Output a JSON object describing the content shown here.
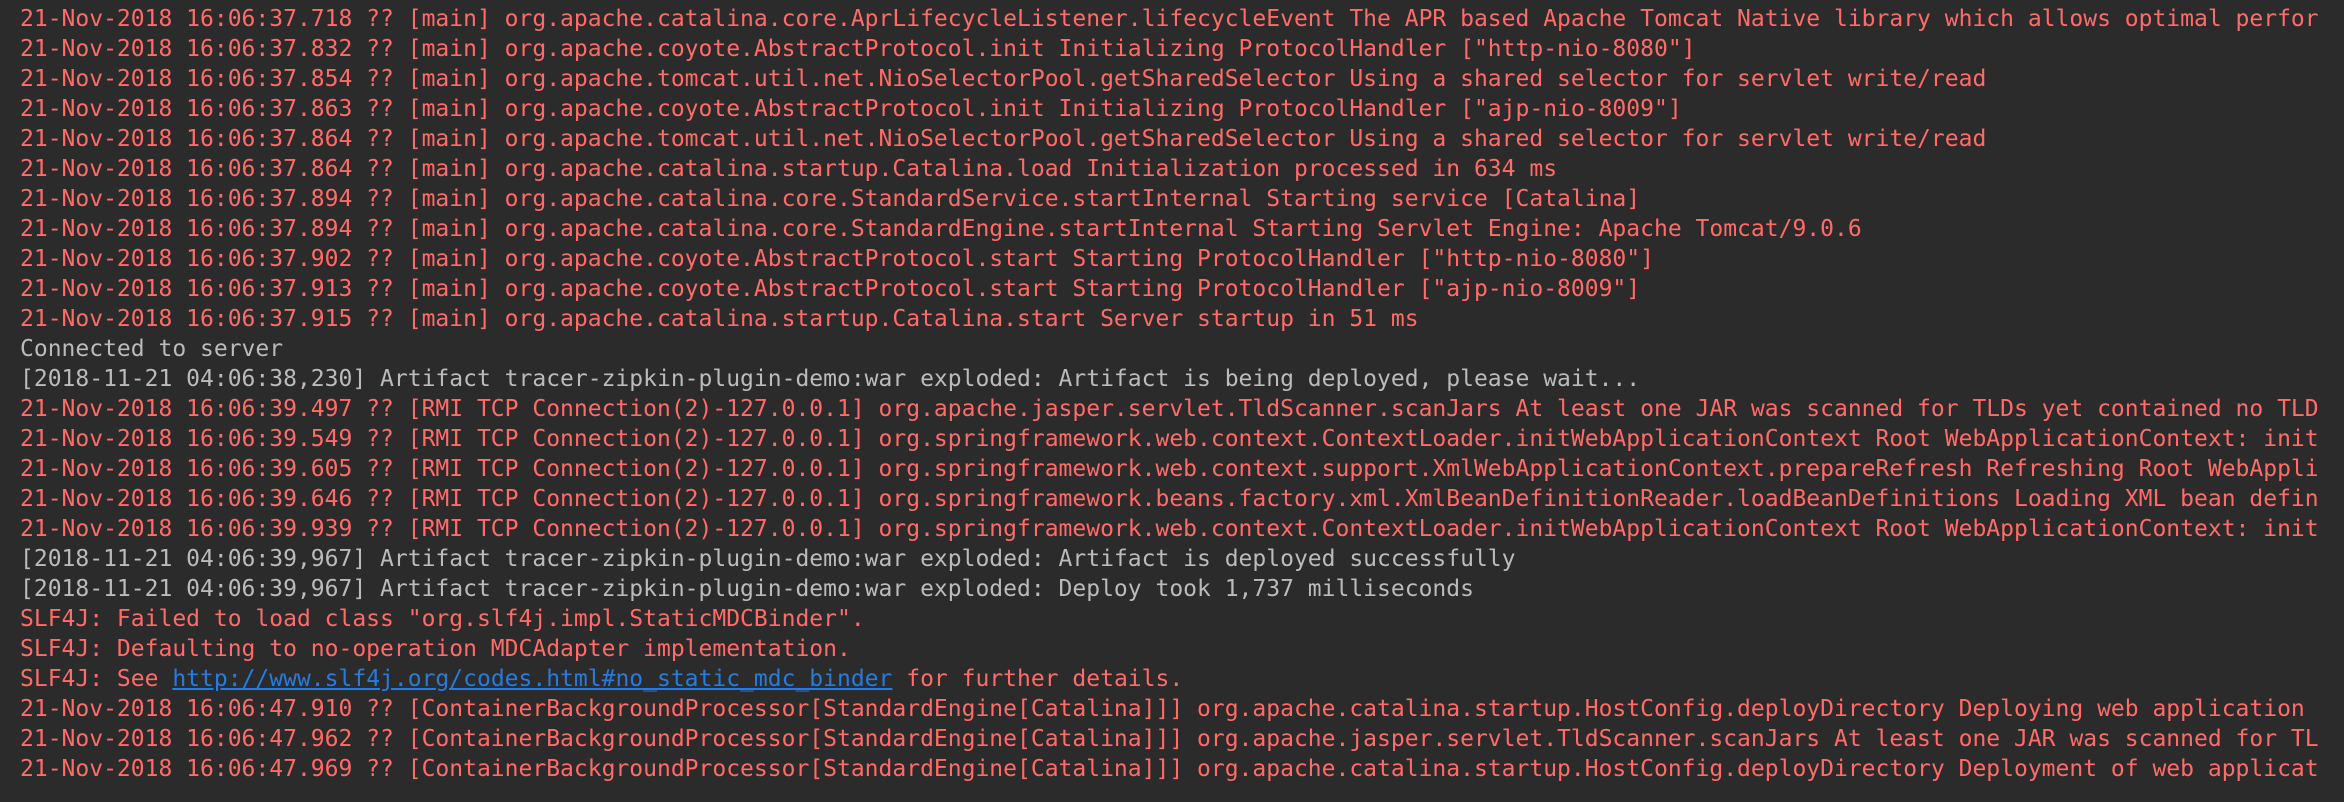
{
  "colors": {
    "background": "#2b2b2b",
    "stderr": "#ff6b68",
    "stdout": "#bbbbbb",
    "link": "#287bde"
  },
  "lines": [
    {
      "kind": "err",
      "text": "21-Nov-2018 16:06:37.718 ?? [main] org.apache.catalina.core.AprLifecycleListener.lifecycleEvent The APR based Apache Tomcat Native library which allows optimal perfor"
    },
    {
      "kind": "err",
      "text": "21-Nov-2018 16:06:37.832 ?? [main] org.apache.coyote.AbstractProtocol.init Initializing ProtocolHandler [\"http-nio-8080\"]"
    },
    {
      "kind": "err",
      "text": "21-Nov-2018 16:06:37.854 ?? [main] org.apache.tomcat.util.net.NioSelectorPool.getSharedSelector Using a shared selector for servlet write/read"
    },
    {
      "kind": "err",
      "text": "21-Nov-2018 16:06:37.863 ?? [main] org.apache.coyote.AbstractProtocol.init Initializing ProtocolHandler [\"ajp-nio-8009\"]"
    },
    {
      "kind": "err",
      "text": "21-Nov-2018 16:06:37.864 ?? [main] org.apache.tomcat.util.net.NioSelectorPool.getSharedSelector Using a shared selector for servlet write/read"
    },
    {
      "kind": "err",
      "text": "21-Nov-2018 16:06:37.864 ?? [main] org.apache.catalina.startup.Catalina.load Initialization processed in 634 ms"
    },
    {
      "kind": "err",
      "text": "21-Nov-2018 16:06:37.894 ?? [main] org.apache.catalina.core.StandardService.startInternal Starting service [Catalina]"
    },
    {
      "kind": "err",
      "text": "21-Nov-2018 16:06:37.894 ?? [main] org.apache.catalina.core.StandardEngine.startInternal Starting Servlet Engine: Apache Tomcat/9.0.6"
    },
    {
      "kind": "err",
      "text": "21-Nov-2018 16:06:37.902 ?? [main] org.apache.coyote.AbstractProtocol.start Starting ProtocolHandler [\"http-nio-8080\"]"
    },
    {
      "kind": "err",
      "text": "21-Nov-2018 16:06:37.913 ?? [main] org.apache.coyote.AbstractProtocol.start Starting ProtocolHandler [\"ajp-nio-8009\"]"
    },
    {
      "kind": "err",
      "text": "21-Nov-2018 16:06:37.915 ?? [main] org.apache.catalina.startup.Catalina.start Server startup in 51 ms"
    },
    {
      "kind": "info",
      "text": "Connected to server"
    },
    {
      "kind": "info",
      "text": "[2018-11-21 04:06:38,230] Artifact tracer-zipkin-plugin-demo:war exploded: Artifact is being deployed, please wait..."
    },
    {
      "kind": "err",
      "text": "21-Nov-2018 16:06:39.497 ?? [RMI TCP Connection(2)-127.0.0.1] org.apache.jasper.servlet.TldScanner.scanJars At least one JAR was scanned for TLDs yet contained no TLD"
    },
    {
      "kind": "err",
      "text": "21-Nov-2018 16:06:39.549 ?? [RMI TCP Connection(2)-127.0.0.1] org.springframework.web.context.ContextLoader.initWebApplicationContext Root WebApplicationContext: init"
    },
    {
      "kind": "err",
      "text": "21-Nov-2018 16:06:39.605 ?? [RMI TCP Connection(2)-127.0.0.1] org.springframework.web.context.support.XmlWebApplicationContext.prepareRefresh Refreshing Root WebAppli"
    },
    {
      "kind": "err",
      "text": "21-Nov-2018 16:06:39.646 ?? [RMI TCP Connection(2)-127.0.0.1] org.springframework.beans.factory.xml.XmlBeanDefinitionReader.loadBeanDefinitions Loading XML bean defin"
    },
    {
      "kind": "err",
      "text": "21-Nov-2018 16:06:39.939 ?? [RMI TCP Connection(2)-127.0.0.1] org.springframework.web.context.ContextLoader.initWebApplicationContext Root WebApplicationContext: init"
    },
    {
      "kind": "info",
      "text": "[2018-11-21 04:06:39,967] Artifact tracer-zipkin-plugin-demo:war exploded: Artifact is deployed successfully"
    },
    {
      "kind": "info",
      "text": "[2018-11-21 04:06:39,967] Artifact tracer-zipkin-plugin-demo:war exploded: Deploy took 1,737 milliseconds"
    },
    {
      "kind": "err",
      "text": "SLF4J: Failed to load class \"org.slf4j.impl.StaticMDCBinder\"."
    },
    {
      "kind": "err",
      "text": "SLF4J: Defaulting to no-operation MDCAdapter implementation."
    },
    {
      "kind": "err",
      "prefix": "SLF4J: See ",
      "link": "http://www.slf4j.org/codes.html#no_static_mdc_binder",
      "suffix": " for further details."
    },
    {
      "kind": "err",
      "text": "21-Nov-2018 16:06:47.910 ?? [ContainerBackgroundProcessor[StandardEngine[Catalina]]] org.apache.catalina.startup.HostConfig.deployDirectory Deploying web application"
    },
    {
      "kind": "err",
      "text": "21-Nov-2018 16:06:47.962 ?? [ContainerBackgroundProcessor[StandardEngine[Catalina]]] org.apache.jasper.servlet.TldScanner.scanJars At least one JAR was scanned for TL"
    },
    {
      "kind": "err",
      "text": "21-Nov-2018 16:06:47.969 ?? [ContainerBackgroundProcessor[StandardEngine[Catalina]]] org.apache.catalina.startup.HostConfig.deployDirectory Deployment of web applicat"
    }
  ]
}
